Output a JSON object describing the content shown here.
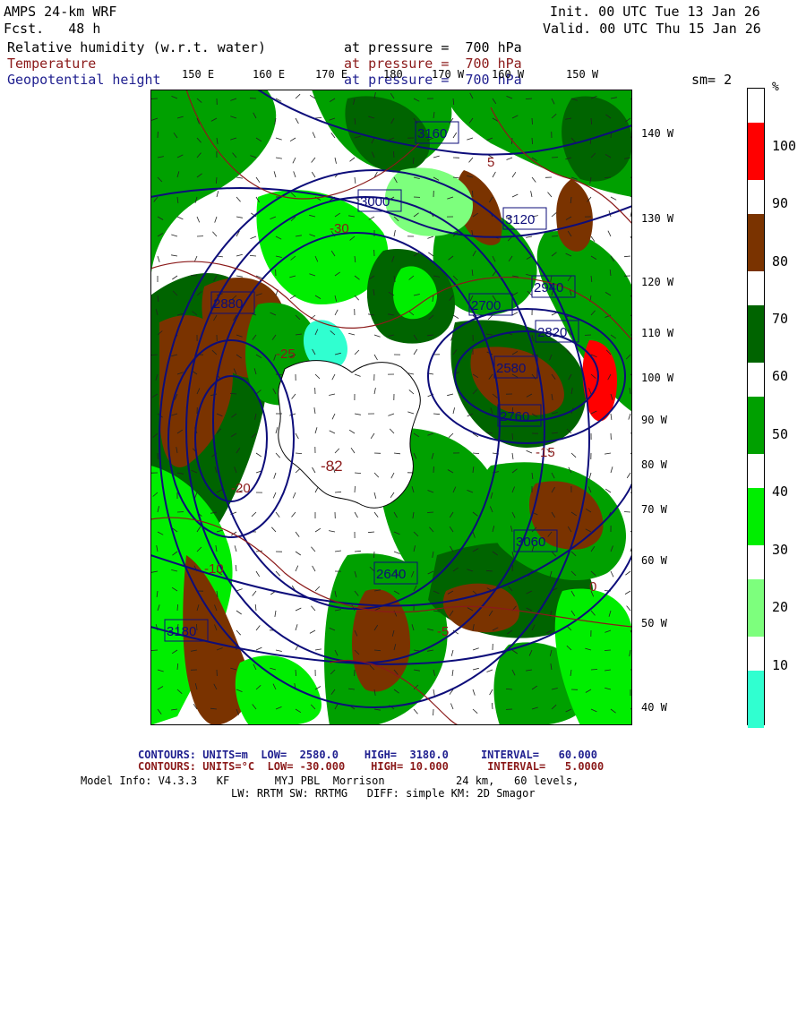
{
  "header": {
    "model": "AMPS 24-km WRF",
    "fcst": "Fcst.   48 h",
    "init": "Init. 00 UTC Tue 13 Jan 26",
    "valid": "Valid. 00 UTC Thu 15 Jan 26",
    "field1": "Relative humidity (w.r.t. water)",
    "field2": "Temperature",
    "field3": "Geopotential height",
    "pressure1": "at pressure =  700 hPa",
    "pressure2": "at pressure =  700 hPa",
    "pressure3": "at pressure =  700 hPa",
    "sm": "sm= 2"
  },
  "lon_labels_top": [
    "150 E",
    "160 E",
    "170 E",
    "180",
    "170 W",
    "160 W",
    "150 W"
  ],
  "lat_labels_right": [
    "140 W",
    "130 W",
    "120 W",
    "110 W",
    "100 W",
    "90 W",
    "80 W",
    "70 W",
    "60 W",
    "50 W",
    "40 W"
  ],
  "colorbar": {
    "unit": "%",
    "labels": [
      "100",
      "90",
      "80",
      "70",
      "60",
      "50",
      "40",
      "30",
      "20",
      "10"
    ],
    "colors": [
      "#ff0000",
      "#7a3300",
      "#006400",
      "#00a000",
      "#00ee00",
      "#7dff7d",
      "#30ffd0",
      "#ffffff",
      "#ffffff",
      "#ffffff"
    ]
  },
  "map": {
    "height_contour_labels": [
      "3160",
      "2940",
      "3120",
      "3000",
      "2880",
      "2700",
      "2580",
      "2760",
      "2640",
      "3180",
      "3060",
      "2820"
    ],
    "temp_contour_labels": [
      "-25",
      "-30",
      "-20",
      "-15",
      "-10",
      "-5",
      "0",
      "5"
    ],
    "pole_label": "-82",
    "colors": {
      "height_line": "#0d0d7a",
      "temp_line": "#8b1a1a",
      "land": "#ffffff"
    }
  },
  "footer": {
    "line1_prefix": "CONTOURS:",
    "line1_units": "UNITS=m",
    "line1_low": "LOW=  2580.0",
    "line1_high": "HIGH=  3180.0",
    "line1_interval": "INTERVAL=   60.000",
    "line2_prefix": "CONTOURS:",
    "line2_units": "UNITS=°C",
    "line2_low": "LOW= -30.000",
    "line2_high": "HIGH= 10.000",
    "line2_interval": "INTERVAL=   5.0000",
    "model_info": "Model Info: V4.3.3   KF       MYJ PBL  Morrison           24 km,   60 levels,",
    "model_info2": "LW: RRTM SW: RRTMG   DIFF: simple KM: 2D Smagor"
  }
}
